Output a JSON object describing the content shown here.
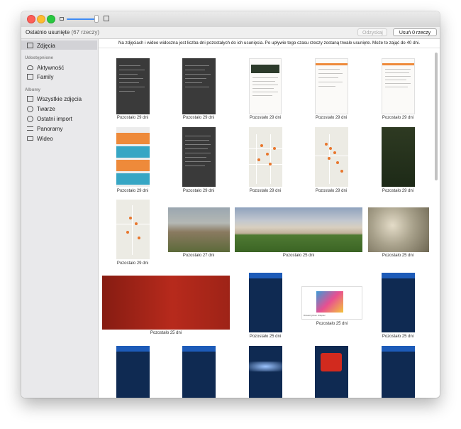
{
  "window": {
    "header_title": "Ostatnio usunięte",
    "header_count": "(67 rzeczy)",
    "recover_label": "Odzyskaj",
    "delete_label": "Usuń 0 rzeczy"
  },
  "sidebar": {
    "top_item": "Zdjęcia",
    "shared_heading": "Udostępnione",
    "shared_items": [
      "Aktywność",
      "Family"
    ],
    "albums_heading": "Albumy",
    "album_items": [
      "Wszystkie zdjęcia",
      "Twarze",
      "Ostatni import",
      "Panoramy",
      "Wideo"
    ]
  },
  "info_text": "Na zdjęciach i wideo widoczna jest liczba dni pozostałych do ich usunięcia. Po upływie tego czasu rzeczy zostaną trwale usunięte. Może to zająć do 40 dni.",
  "captions": {
    "d29": "Pozostało 29 dni",
    "d27": "Pozostało 27 dni",
    "d25": "Pozostało 25 dni"
  },
  "web_snippet": "Dziewczynka i chłopiec"
}
